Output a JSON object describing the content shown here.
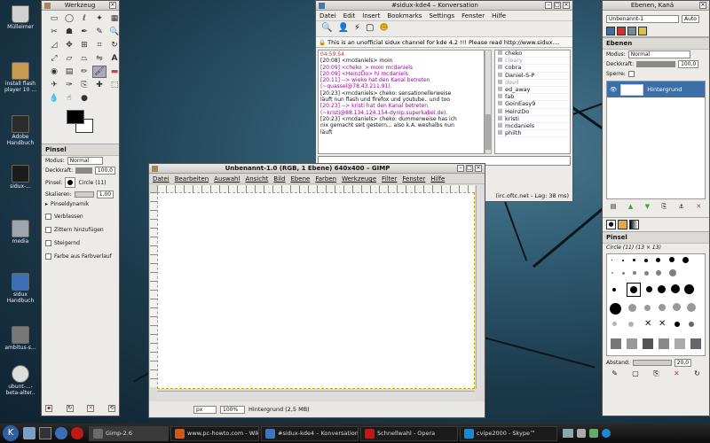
{
  "desktop": {
    "icons": [
      {
        "label": "Mülleimer",
        "icon": "trash-icon"
      },
      {
        "label": "install flash player 10 ...",
        "icon": "archive-icon"
      },
      {
        "label": "Adobe Handbuch",
        "icon": "book-icon"
      },
      {
        "label": "sidux-...",
        "icon": "sidux-icon"
      },
      {
        "label": "media",
        "icon": "drive-icon"
      },
      {
        "label": "sidux Handbuch",
        "icon": "kde-icon"
      },
      {
        "label": "ambitus-s...",
        "icon": "disk-icon"
      },
      {
        "label": "ubunt-...-beta-alter..",
        "icon": "cd-icon"
      }
    ]
  },
  "toolbox": {
    "title": "Werkzeug",
    "tool_options_title": "Pinsel",
    "mode_label": "Modus:",
    "mode_value": "Normal",
    "opacity_label": "Deckkraft:",
    "opacity_value": "100,0",
    "opacity_level": 1.0,
    "brush_label": "Pinsel:",
    "brush_value": "Circle (11)",
    "scale_label": "Skalieren:",
    "scale_value": "1,00",
    "dynamics_label": "Pinseldynamik",
    "options": [
      "Verblassen",
      "Zittern hinzufügen",
      "Steigernd",
      "Farbe aus Farbverlauf"
    ]
  },
  "konversation": {
    "title": "#sidux-kde4 – Konversation",
    "menu": [
      "Datei",
      "Edit",
      "Insert",
      "Bookmarks",
      "Settings",
      "Fenster",
      "Hilfe"
    ],
    "topic": "This is an unofficial sidux channel for kde 4.2 !!! Please read http://www.sidux....",
    "messages": [
      {
        "text": "04:59:54.",
        "color": "#c03030"
      },
      {
        "text": "[20:08] <mcdaniels> moin",
        "color": "#111111"
      },
      {
        "text": "[20:09] <cheko_> moin mcdaniels",
        "color": "#a000a0"
      },
      {
        "text": "[20:09] <HeinzDo> hi mcdaniels",
        "color": "#a000a0"
      },
      {
        "text": "[20:11] --> wieko hat den Kanal betreten",
        "color": "#a000a0"
      },
      {
        "text": "(~quassel@78.43.211.91).",
        "color": "#a000a0"
      },
      {
        "text": "[20:23] <mcdaniels> cheko: sensationellerweise",
        "color": "#111111"
      },
      {
        "text": "läuft nun flash und firefox und youtube.. und too",
        "color": "#111111"
      },
      {
        "text": "[20:23] --> kristi hat den Kanal betreten",
        "color": "#a000a0"
      },
      {
        "text": "(~kristi@88.134.124.154-dynip.superkabel.de).",
        "color": "#a000a0"
      },
      {
        "text": "[20:23] <mcdaniels> cheko: dummerweise has ich",
        "color": "#111111"
      },
      {
        "text": "nix gemacht seit gestern... also k.A. weshalbs nun",
        "color": "#111111"
      },
      {
        "text": "läuft",
        "color": "#111111"
      }
    ],
    "nicks": [
      "cheko",
      "cleary",
      "cobra",
      "Daniel-S-P",
      "devil",
      "ed_away",
      "fab",
      "GoinEasy9",
      "HeinzDo",
      "kristi",
      "mcdaniels",
      "philth"
    ],
    "status": "(irc.oftc.net - Lag: 38 ms)"
  },
  "gimp_image": {
    "title": "Unbenannt-1.0 (RGB, 1 Ebene) 640x400 – GIMP",
    "menu": [
      "Datei",
      "Bearbeiten",
      "Auswahl",
      "Ansicht",
      "Bild",
      "Ebene",
      "Farben",
      "Werkzeuge",
      "Filter",
      "Fenster",
      "Hilfe"
    ],
    "unit": "px",
    "zoom": "100%",
    "status": "Hintergrund (2,5 MB)"
  },
  "layers": {
    "title": "Ebenen, Kanä",
    "image_select": "Unbenannt-1",
    "auto_label": "Auto",
    "section": "Ebenen",
    "mode_label": "Modus:",
    "mode_value": "Normal",
    "opacity_label": "Deckkraft:",
    "opacity_value": "100,0",
    "lock_label": "Sperre:",
    "layer_name": "Hintergrund",
    "brushes_title": "Pinsel",
    "brush_name": "Circle (11) (13 × 13)",
    "spacing_label": "Abstand:",
    "spacing_value": "20,0"
  },
  "taskbar": {
    "tasks": [
      {
        "label": "Gimp-2.6",
        "color": "#6a6a6a"
      },
      {
        "label": "www.pc-howto.com - Wiki...",
        "color": "#c85a1a"
      },
      {
        "label": "#sidux-kde4 – Konversation",
        "color": "#3a78c0"
      },
      {
        "label": "Schnellwahl - Opera",
        "color": "#c01818"
      },
      {
        "label": "cvipe2000 - Skype™",
        "color": "#1a8ad0"
      }
    ]
  },
  "colors": {
    "accent": "#3c6ea8",
    "selection": "#2f67a8",
    "link": "#0000cc"
  }
}
